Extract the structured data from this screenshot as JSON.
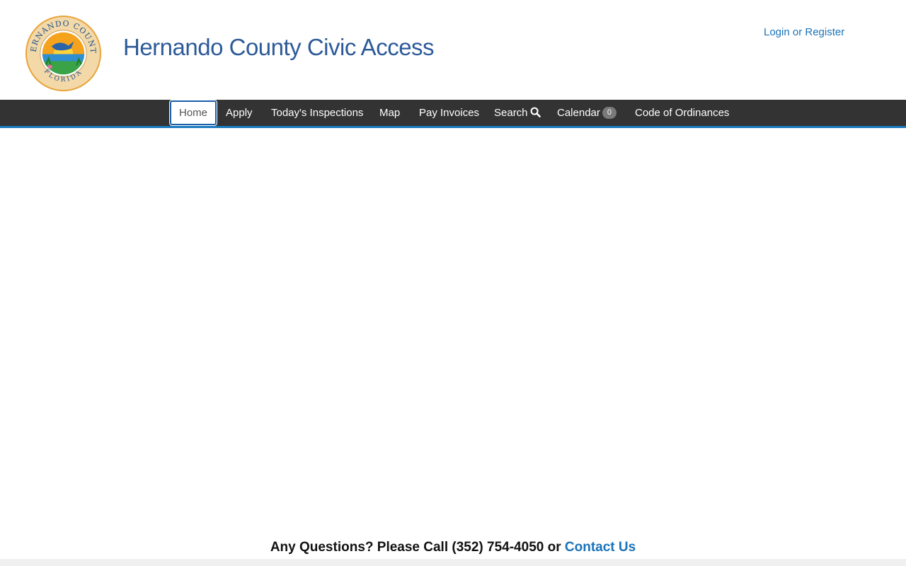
{
  "header": {
    "seal": {
      "arc_top": "HERNANDO COUNTY",
      "arc_bottom": "FLORIDA",
      "colors": {
        "ring": "#f3d9a8",
        "sky": "#f5a21c",
        "sun": "#ffd23a",
        "water": "#2f8fd0",
        "land": "#3aa347",
        "bird": "#2a63a8",
        "text": "#1f4f8a"
      }
    },
    "site_title": "Hernando County Civic Access",
    "login_link": "Login or Register"
  },
  "nav": {
    "home": "Home",
    "apply": "Apply",
    "todays_inspections": "Today's Inspections",
    "map": "Map",
    "pay_invoices": "Pay Invoices",
    "search": "Search",
    "search_icon": "search-icon",
    "calendar": "Calendar",
    "calendar_count": "0",
    "code_of_ordinances": "Code of Ordinances"
  },
  "footer": {
    "questions_text": "Any Questions? Please Call (352) 754-4050 or ",
    "contact_link": "Contact Us"
  },
  "colors": {
    "title": "#2d5a99",
    "link": "#1a73b8",
    "navbar_bg": "#333333",
    "navbar_accent": "#1a7bbf",
    "badge_bg": "#7a7a7a"
  }
}
